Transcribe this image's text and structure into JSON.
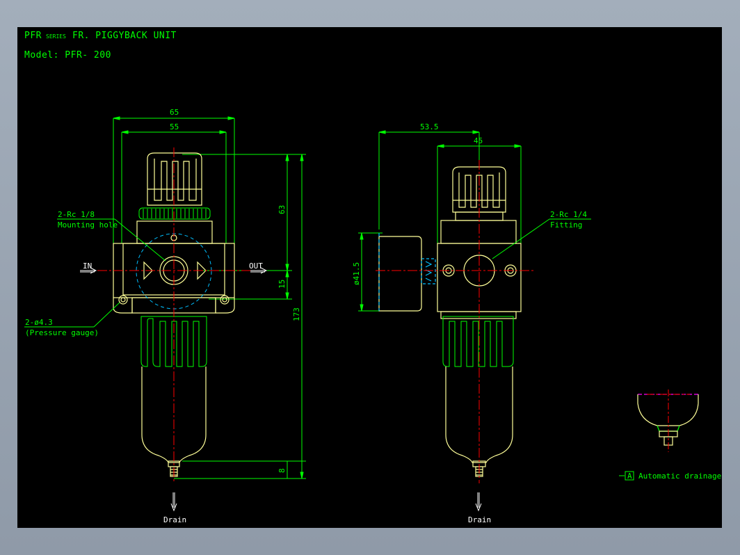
{
  "title": {
    "prefix": "PFR",
    "series": "SERIES",
    "name": "FR. PIGGYBACK UNIT",
    "model": "Model: PFR- 200"
  },
  "front_view": {
    "dim_width_outer": "65",
    "dim_width_inner": "55",
    "dim_height_top": "63",
    "dim_height_mid": "15",
    "dim_height_total": "173",
    "dim_height_drain": "8",
    "port_in": "IN",
    "port_out": "OUT",
    "mount_callout_line1": "2-Rc 1/8",
    "mount_callout_line2": "Mounting hole",
    "gauge_callout_line1": "2-ø4.3",
    "gauge_callout_line2": "(Pressure gauge)",
    "drain": "Drain"
  },
  "side_view": {
    "dim_depth_total": "53.5",
    "dim_depth_body": "45",
    "dim_diameter": "ø41.5",
    "fitting_callout_line1": "2-Rc 1/4",
    "fitting_callout_line2": "Fitting",
    "drain": "Drain"
  },
  "detail": {
    "tag": "A",
    "label": "Automatic drainage"
  },
  "colors": {
    "background": "#000000",
    "outline": "#ffff99",
    "dimension": "#00ff00",
    "centerline": "#ff0000",
    "hidden": "#00bfff",
    "drain_text": "#ffffff",
    "detail_top": "#ff00ff"
  }
}
